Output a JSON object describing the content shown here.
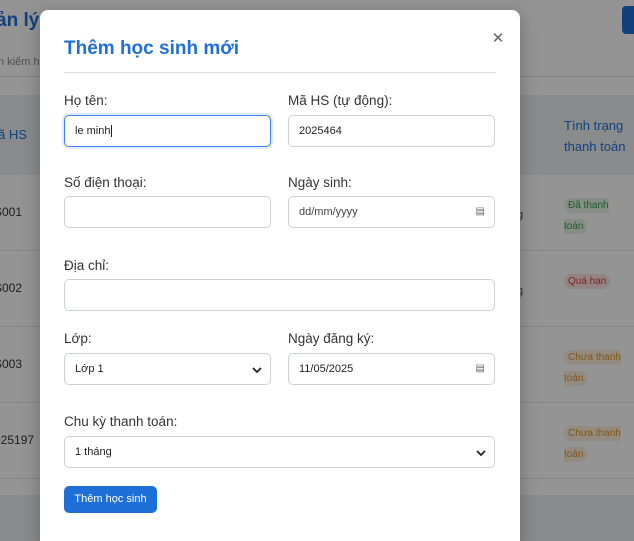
{
  "background": {
    "title": "ản lý",
    "search_placeholder": "n kiếm họ",
    "table_headers": {
      "left": "ã HS",
      "right": "Tình trạng thanh toán"
    },
    "rows": [
      {
        "id": "S001",
        "status": "Đã thanh toán",
        "status_kind": "paid"
      },
      {
        "id": "S002",
        "status": "Quá hạn",
        "status_kind": "late"
      },
      {
        "id": "S003",
        "status": "Chưa thanh toán",
        "status_kind": "unpaid"
      },
      {
        "id": "025197",
        "status": "Chưa thanh toán",
        "status_kind": "unpaid"
      }
    ]
  },
  "modal": {
    "title": "Thêm học sinh mới",
    "close_icon": "close-icon",
    "fields": {
      "name": {
        "label": "Họ tên:",
        "value": "le minh"
      },
      "student_id": {
        "label": "Mã HS (tự động):",
        "value": "2025464"
      },
      "phone": {
        "label": "Số điện thoại:",
        "value": ""
      },
      "birthdate": {
        "label": "Ngày sinh:",
        "value": "dd/mm/yyyy"
      },
      "address": {
        "label": "Địa chỉ:",
        "value": ""
      },
      "class": {
        "label": "Lớp:",
        "value": "Lớp 1"
      },
      "enroll_date": {
        "label": "Ngày đăng ký:",
        "value": "11/05/2025"
      },
      "billing_cycle": {
        "label": "Chu kỳ thanh toán:",
        "value": "1 tháng"
      }
    },
    "submit_label": "Thêm học sinh"
  },
  "colors": {
    "accent": "#1f6fd8",
    "focus": "#3b82f6"
  }
}
